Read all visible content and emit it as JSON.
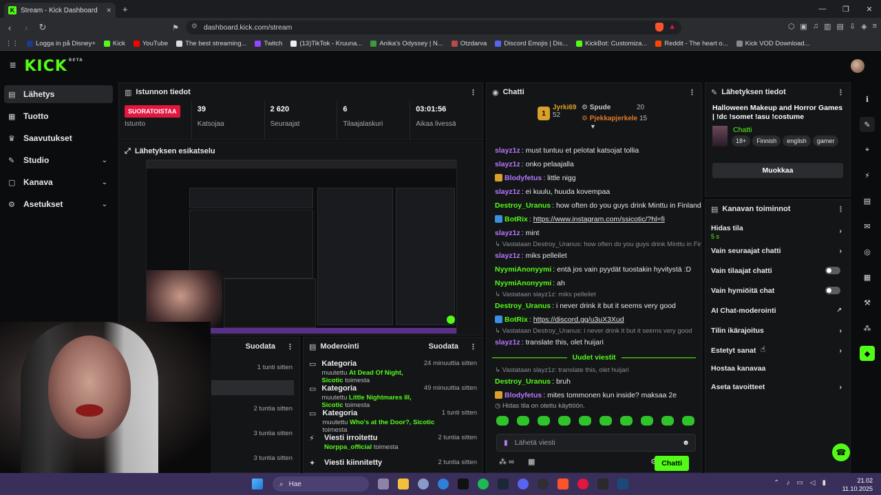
{
  "browser": {
    "tab_title": "Stream - Kick Dashboard",
    "tab_close": "✕",
    "new_tab": "+",
    "url": "dashboard.kick.com/stream",
    "window_controls": [
      "—",
      "❐",
      "✕"
    ],
    "bookmarks": [
      {
        "label": "Logga in på Disney+",
        "color": "#1a3a8a"
      },
      {
        "label": "Kick",
        "color": "#53fc18"
      },
      {
        "label": "YouTube",
        "color": "#ff0000"
      },
      {
        "label": "The best streaming...",
        "color": "#dddddd"
      },
      {
        "label": "Twitch",
        "color": "#9146ff"
      },
      {
        "label": "(13)TikTok - Kruuna...",
        "color": "#eeeeee"
      },
      {
        "label": "Anika's Odyssey | N...",
        "color": "#3c9a3c"
      },
      {
        "label": "Otzdarva",
        "color": "#b84a4a"
      },
      {
        "label": "Discord Emojis | Dis...",
        "color": "#5865f2"
      },
      {
        "label": "KickBot: Customiza...",
        "color": "#53fc18"
      },
      {
        "label": "Reddit - The heart o...",
        "color": "#ff4500"
      },
      {
        "label": "Kick VOD Download...",
        "color": "#888888"
      }
    ]
  },
  "header": {
    "logo": "KICK",
    "beta": "BETA"
  },
  "sidebar": {
    "items": [
      {
        "label": "Lähetys",
        "icon": "broadcast-icon",
        "glyph": "▤",
        "active": true,
        "chev": ""
      },
      {
        "label": "Tuotto",
        "icon": "revenue-icon",
        "glyph": "▦",
        "active": false,
        "chev": ""
      },
      {
        "label": "Saavutukset",
        "icon": "trophy-icon",
        "glyph": "♛",
        "active": false,
        "chev": ""
      },
      {
        "label": "Studio",
        "icon": "studio-icon",
        "glyph": "✎",
        "active": false,
        "chev": "⌄"
      },
      {
        "label": "Kanava",
        "icon": "channel-icon",
        "glyph": "▢",
        "active": false,
        "chev": "⌄"
      },
      {
        "label": "Asetukset",
        "icon": "settings-icon",
        "glyph": "⚙",
        "active": false,
        "chev": "⌄"
      }
    ]
  },
  "session": {
    "title": "Istunnon tiedot",
    "live_badge": "SUORATOISTAA",
    "live_label": "Istunto",
    "stats": [
      {
        "value": "39",
        "label": "Katsojaa"
      },
      {
        "value": "2 620",
        "label": "Seuraajat"
      },
      {
        "value": "6",
        "label": "Tilaajalaskuri"
      },
      {
        "value": "03:01:56",
        "label": "Aikaa livessä"
      }
    ]
  },
  "preview": {
    "title": "Lähetyksen esikatselu"
  },
  "activity": {
    "filter": "Suodata",
    "times": [
      "1 tunti sitten",
      "2 tuntia sitten",
      "3 tuntia sitten",
      "3 tuntia sitten"
    ]
  },
  "moderation": {
    "title": "Moderointi",
    "filter": "Suodata",
    "rows": [
      {
        "title": "Kategoria",
        "pre": "muutettu ",
        "target": "At Dead Of Night, Sicotic",
        "post": " toimesta",
        "time": "24 minuuttia sitten",
        "icon": "category-icon",
        "glyph": "▭"
      },
      {
        "title": "Kategoria",
        "pre": "muutettu ",
        "target": "Little Nightmares III, Sicotic",
        "post": " toimesta",
        "time": "49 minuuttia sitten",
        "icon": "category-icon",
        "glyph": "▭"
      },
      {
        "title": "Kategoria",
        "pre": "muutettu ",
        "target": "Who's at the Door?, Sicotic",
        "post": " toimesta",
        "time": "1 tunti sitten",
        "icon": "category-icon",
        "glyph": "▭"
      },
      {
        "title": "Viesti irroitettu",
        "pre": "",
        "target": "Norppa_official",
        "post": " toimesta",
        "time": "2 tuntia sitten",
        "icon": "unpin-icon",
        "glyph": "⚡"
      },
      {
        "title": "Viesti kiinnitetty",
        "pre": "",
        "target": "",
        "post": "",
        "time": "2 tuntia sitten",
        "icon": "pin-icon",
        "glyph": "✦"
      }
    ]
  },
  "chat": {
    "title": "Chatti",
    "leaders": [
      {
        "name": "Jyrki69",
        "count": "52"
      },
      {
        "name": "Spude",
        "count": "20"
      },
      {
        "name": "Pjekkapjerkele",
        "count": "15"
      }
    ],
    "rank": "1",
    "lines": [
      {
        "type": "msg",
        "user": "slayz1z",
        "color": "#b779ff",
        "badge": "",
        "text": ": must tuntuu et pelotat katsojat tollia"
      },
      {
        "type": "msg",
        "user": "slayz1z",
        "color": "#b779ff",
        "badge": "",
        "text": ": onko pelaajalla"
      },
      {
        "type": "msg",
        "user": "Blodyfetus",
        "color": "#b779ff",
        "badge": "#d9a12b",
        "text": ": little nigg"
      },
      {
        "type": "msg",
        "user": "slayz1z",
        "color": "#b779ff",
        "badge": "",
        "text": ": ei kuulu, huuda kovempaa"
      },
      {
        "type": "msg",
        "user": "Destroy_Uranus",
        "color": "#53fc18",
        "badge": "",
        "text": ": how often do you guys drink Minttu in Finland"
      },
      {
        "type": "link",
        "user": "BotRix",
        "color": "#53fc18",
        "badge": "#3a8fe0",
        "text": ": ",
        "link": "https://www.instagram.com/ssicotic/?hl=fi"
      },
      {
        "type": "msg",
        "user": "slayz1z",
        "color": "#b779ff",
        "badge": "",
        "text": ": mint"
      },
      {
        "type": "reply",
        "text": "↳ Vastataan Destroy_Uranus: how often do you guys drink Minttu in Finla..."
      },
      {
        "type": "msg",
        "user": "slayz1z",
        "color": "#b779ff",
        "badge": "",
        "text": ": miks pelleilet"
      },
      {
        "type": "msg",
        "user": "NyymiAnonyymi",
        "color": "#53fc18",
        "badge": "",
        "text": ": entä jos vain pyydät tuostakin hyvitystä :D"
      },
      {
        "type": "msg",
        "user": "NyymiAnonyymi",
        "color": "#53fc18",
        "badge": "",
        "text": ": ah"
      },
      {
        "type": "reply",
        "text": "↳ Vastataan slayz1z: miks pelleilet"
      },
      {
        "type": "msg",
        "user": "Destroy_Uranus",
        "color": "#53fc18",
        "badge": "",
        "text": ": i never drink it but it seems very good"
      },
      {
        "type": "link",
        "user": "BotRix",
        "color": "#53fc18",
        "badge": "#3a8fe0",
        "text": ": ",
        "link": "https://discord.gg/u3uX3Xud"
      },
      {
        "type": "reply",
        "text": "↳ Vastataan Destroy_Uranus: i never drink it but it seems very good"
      },
      {
        "type": "msg",
        "user": "slayz1z",
        "color": "#b779ff",
        "badge": "",
        "text": ": translate this, olet huijari"
      }
    ],
    "new_messages": "Uudet viestit",
    "lines2": [
      {
        "type": "reply",
        "text": "↳ Vastataan slayz1z: translate this, olet huijari"
      },
      {
        "type": "msg",
        "user": "Destroy_Uranus",
        "color": "#53fc18",
        "badge": "",
        "text": ": bruh"
      },
      {
        "type": "msg",
        "user": "Blodyfetus",
        "color": "#b779ff",
        "badge": "#d9a12b",
        "text": ": mites tommonen kun inside? maksaa 2e"
      }
    ],
    "slow_notice": "Hidas tila on otettu käyttöön.",
    "input_placeholder": "Lähetä viesti",
    "send_label": "Chatti"
  },
  "info": {
    "title": "Lähetyksen tiedot",
    "stream_title": "Halloween Makeup and Horror Games | !dc !somet !asu !costume",
    "category": "Chatti",
    "tags": [
      "18+",
      "Finnish",
      "english",
      "gamer"
    ],
    "edit_label": "Muokkaa"
  },
  "channel_actions": {
    "title": "Kanavan toiminnot",
    "rows": [
      {
        "label": "Hidas tila",
        "sub": "5 s",
        "control": "chev"
      },
      {
        "label": "Vain seuraajat chatti",
        "sub": "",
        "control": "chev"
      },
      {
        "label": "Vain tilaajat chatti",
        "sub": "",
        "control": "toggle"
      },
      {
        "label": "Vain hymiöitä chat",
        "sub": "",
        "control": "toggle"
      },
      {
        "label": "AI Chat-moderointi",
        "sub": "",
        "control": "ext"
      },
      {
        "label": "Tilin ikärajoitus",
        "sub": "",
        "control": "chev"
      },
      {
        "label": "Estetyt sanat",
        "sub": "",
        "control": "chev"
      },
      {
        "label": "Hostaa kanavaa",
        "sub": "",
        "control": "none"
      },
      {
        "label": "Aseta tavoitteet",
        "sub": "",
        "control": "chev"
      }
    ]
  },
  "taskbar": {
    "search": "Hae",
    "time": "21.02",
    "date": "11.10.2025"
  },
  "colors": {
    "accent": "#53fc18",
    "live": "#e3163f",
    "bg": "#0b0c0e",
    "panel": "#141517"
  }
}
